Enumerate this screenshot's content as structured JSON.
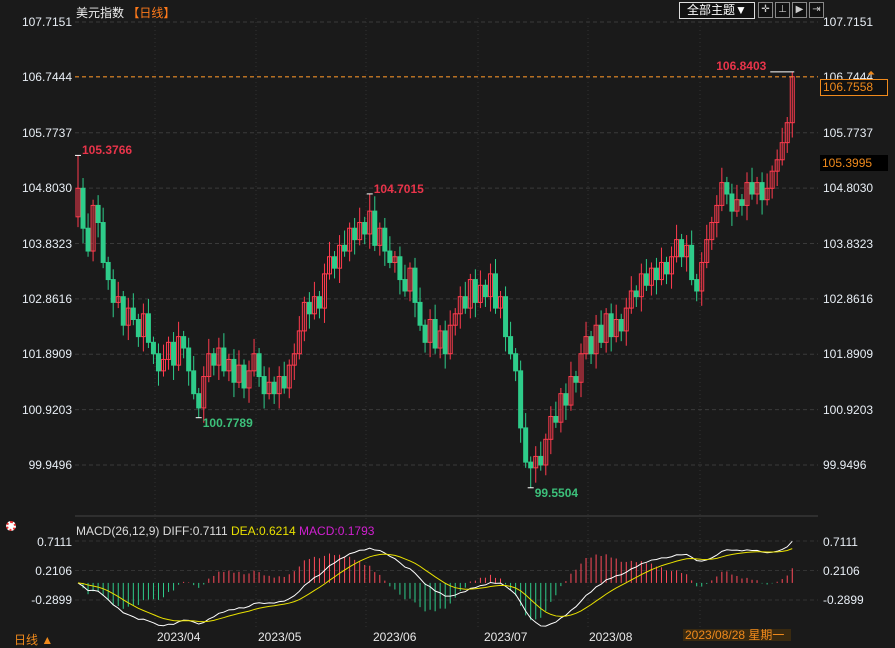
{
  "header": {
    "symbol": "美元指数",
    "timeframe": "【日线】",
    "theme_button": "全部主题▼",
    "tools": [
      "crosshair",
      "axis",
      "play",
      "exit"
    ]
  },
  "price_axis": {
    "labels": [
      "107.7151",
      "106.7444",
      "105.7737",
      "104.8030",
      "103.8323",
      "102.8616",
      "101.8909",
      "100.9203",
      "99.9496"
    ],
    "values": [
      107.7151,
      106.7444,
      105.7737,
      104.803,
      103.8323,
      102.8616,
      101.8909,
      100.9203,
      99.9496
    ]
  },
  "current_price": "106.7558",
  "current_value": 106.7558,
  "reference_price": "105.3995",
  "annotations": [
    {
      "label": "105.3766",
      "value": 105.3766,
      "index": 0,
      "type": "high",
      "color": "#e8344a"
    },
    {
      "label": "100.7789",
      "value": 100.7789,
      "index": 24,
      "type": "low",
      "color": "#3cc07a"
    },
    {
      "label": "104.7015",
      "value": 104.7015,
      "index": 58,
      "type": "high",
      "color": "#e8344a"
    },
    {
      "label": "99.5504",
      "value": 99.5504,
      "index": 90,
      "type": "low",
      "color": "#3cc07a"
    },
    {
      "label": "106.8403",
      "value": 106.8403,
      "index": 142,
      "type": "high",
      "color": "#e8344a"
    }
  ],
  "chart_data": {
    "type": "candlestick",
    "title": "美元指数 日线",
    "first_open": 104.3,
    "closes": [
      104.8,
      104.1,
      103.7,
      104.5,
      104.2,
      103.5,
      103.2,
      102.8,
      102.9,
      102.4,
      102.7,
      102.5,
      102.2,
      102.6,
      102.1,
      101.9,
      101.6,
      101.8,
      102.1,
      101.7,
      102.2,
      102.0,
      101.6,
      101.2,
      100.95,
      101.5,
      101.9,
      101.7,
      102.0,
      101.6,
      101.8,
      101.4,
      101.7,
      101.3,
      101.6,
      101.9,
      101.5,
      101.2,
      101.4,
      101.2,
      101.5,
      101.3,
      101.7,
      101.9,
      102.3,
      102.8,
      102.6,
      102.9,
      102.7,
      103.3,
      103.6,
      103.4,
      103.8,
      103.7,
      104.1,
      103.9,
      104.2,
      104.0,
      104.4,
      103.8,
      104.1,
      103.7,
      103.5,
      103.6,
      103.2,
      103.0,
      103.4,
      102.8,
      102.4,
      102.1,
      102.5,
      102.0,
      102.3,
      101.9,
      102.4,
      102.6,
      102.9,
      102.7,
      103.2,
      102.8,
      103.1,
      102.9,
      103.3,
      102.7,
      102.9,
      102.2,
      101.9,
      101.6,
      100.6,
      100.0,
      99.9,
      100.1,
      99.95,
      100.4,
      100.8,
      100.7,
      101.2,
      101.0,
      101.5,
      101.4,
      101.9,
      102.2,
      101.9,
      102.4,
      102.1,
      102.6,
      102.2,
      102.5,
      102.3,
      102.7,
      103.0,
      102.9,
      103.3,
      103.1,
      103.4,
      103.2,
      103.5,
      103.3,
      103.6,
      103.9,
      103.6,
      103.8,
      103.2,
      103.0,
      103.5,
      103.9,
      104.2,
      104.5,
      104.9,
      104.7,
      104.4,
      104.6,
      104.5,
      104.9,
      104.7,
      104.9,
      104.6,
      104.8,
      105.1,
      105.3,
      105.6,
      105.95,
      106.7558
    ],
    "ylim": [
      99.9496,
      107.7151
    ],
    "x_labels": [
      "2023/04",
      "2023/05",
      "2023/06",
      "2023/07",
      "2023/08"
    ],
    "colors": {
      "up": "#ff3b4e",
      "down": "#2ecc8a"
    }
  },
  "macd": {
    "legend_name": "MACD(26,12,9)",
    "diff": "DIFF:0.7111",
    "dea": "DEA:0.6214",
    "macd": "MACD:0.1793",
    "axis_labels": [
      "0.7111",
      "0.2106",
      "-0.2899"
    ],
    "axis_values": [
      0.7111,
      0.2106,
      -0.2899
    ],
    "colors": {
      "diff": "#ffffff",
      "dea": "#e8e000",
      "macd": "#d020d0"
    }
  },
  "footer": {
    "timeframe": "日线 ▲",
    "cursor_date": "2023/08/28 星期一"
  }
}
